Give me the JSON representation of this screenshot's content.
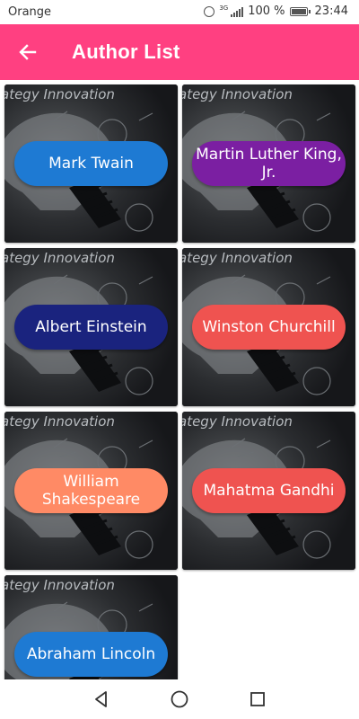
{
  "status_bar": {
    "carrier": "Orange",
    "network": "3G",
    "battery": "100 %",
    "time": "23:44"
  },
  "app_bar": {
    "title": "Author List",
    "back_icon": "arrow-left-icon",
    "color": "#ff4081"
  },
  "card_image": {
    "caption": "ategy Innovation"
  },
  "authors": [
    {
      "name": "Mark Twain",
      "color": "#1e7ad3"
    },
    {
      "name": "Martin Luther King, Jr.",
      "color": "#7b1fa2"
    },
    {
      "name": "Albert Einstein",
      "color": "#1a237e"
    },
    {
      "name": "Winston Churchill",
      "color": "#ef5350"
    },
    {
      "name": "William Shakespeare",
      "color": "#ff8a65"
    },
    {
      "name": "Mahatma Gandhi",
      "color": "#ef5350"
    },
    {
      "name": "Abraham Lincoln",
      "color": "#1e7ad3"
    }
  ],
  "nav_bar": {
    "back_icon": "triangle-back-icon",
    "home_icon": "circle-home-icon",
    "recents_icon": "square-recents-icon"
  }
}
